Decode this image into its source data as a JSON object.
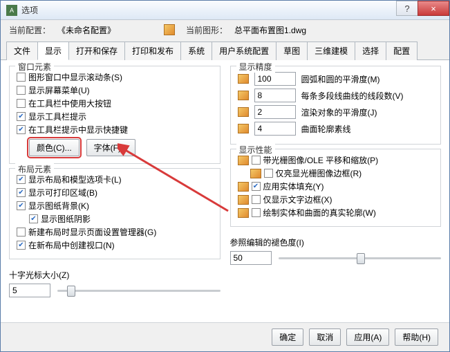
{
  "window": {
    "title": "选项",
    "help": "?",
    "close": "×"
  },
  "header": {
    "curCfgLbl": "当前配置：",
    "curCfgVal": "《未命名配置》",
    "curDwgLbl": "当前图形：",
    "curDwgVal": "总平面布置图1.dwg"
  },
  "tabs": [
    "文件",
    "显示",
    "打开和保存",
    "打印和发布",
    "系统",
    "用户系统配置",
    "草图",
    "三维建模",
    "选择",
    "配置"
  ],
  "activeTab": 1,
  "winElem": {
    "title": "窗口元素",
    "items": [
      {
        "on": false,
        "label": "图形窗口中显示滚动条(S)"
      },
      {
        "on": false,
        "label": "显示屏幕菜单(U)"
      },
      {
        "on": false,
        "label": "在工具栏中使用大按钮"
      },
      {
        "on": true,
        "label": "显示工具栏提示"
      },
      {
        "on": true,
        "label": "在工具栏提示中显示快捷键"
      }
    ],
    "colorBtn": "颜色(C)...",
    "fontBtn": "字体(F)..."
  },
  "layout": {
    "title": "布局元素",
    "items": [
      {
        "on": true,
        "label": "显示布局和模型选项卡(L)"
      },
      {
        "on": true,
        "label": "显示可打印区域(B)"
      },
      {
        "on": true,
        "label": "显示图纸背景(K)"
      },
      {
        "on": true,
        "label": "显示图纸阴影",
        "indent": true
      },
      {
        "on": false,
        "label": "新建布局时显示页面设置管理器(G)"
      },
      {
        "on": true,
        "label": "在新布局中创建视口(N)"
      }
    ]
  },
  "cross": {
    "title": "十字光标大小(Z)",
    "value": "5",
    "thumb": 6
  },
  "precision": {
    "title": "显示精度",
    "rows": [
      {
        "val": "100",
        "label": "圆弧和圆的平滑度(M)"
      },
      {
        "val": "8",
        "label": "每条多段线曲线的线段数(V)"
      },
      {
        "val": "2",
        "label": "渲染对象的平滑度(J)"
      },
      {
        "val": "4",
        "label": "曲面轮廓素线"
      }
    ]
  },
  "perf": {
    "title": "显示性能",
    "items": [
      {
        "on": false,
        "label": "带光栅图像/OLE 平移和缩放(P)"
      },
      {
        "on": false,
        "label": "仅亮显光栅图像边框(R)",
        "indent": true
      },
      {
        "on": true,
        "label": "应用实体填充(Y)"
      },
      {
        "on": false,
        "label": "仅显示文字边框(X)"
      },
      {
        "on": false,
        "label": "绘制实体和曲面的真实轮廓(W)"
      }
    ]
  },
  "fade": {
    "title": "参照编辑的褪色度(I)",
    "value": "50",
    "thumb": 48
  },
  "footer": {
    "ok": "确定",
    "cancel": "取消",
    "apply": "应用(A)",
    "help": "帮助(H)"
  },
  "watermark": ""
}
